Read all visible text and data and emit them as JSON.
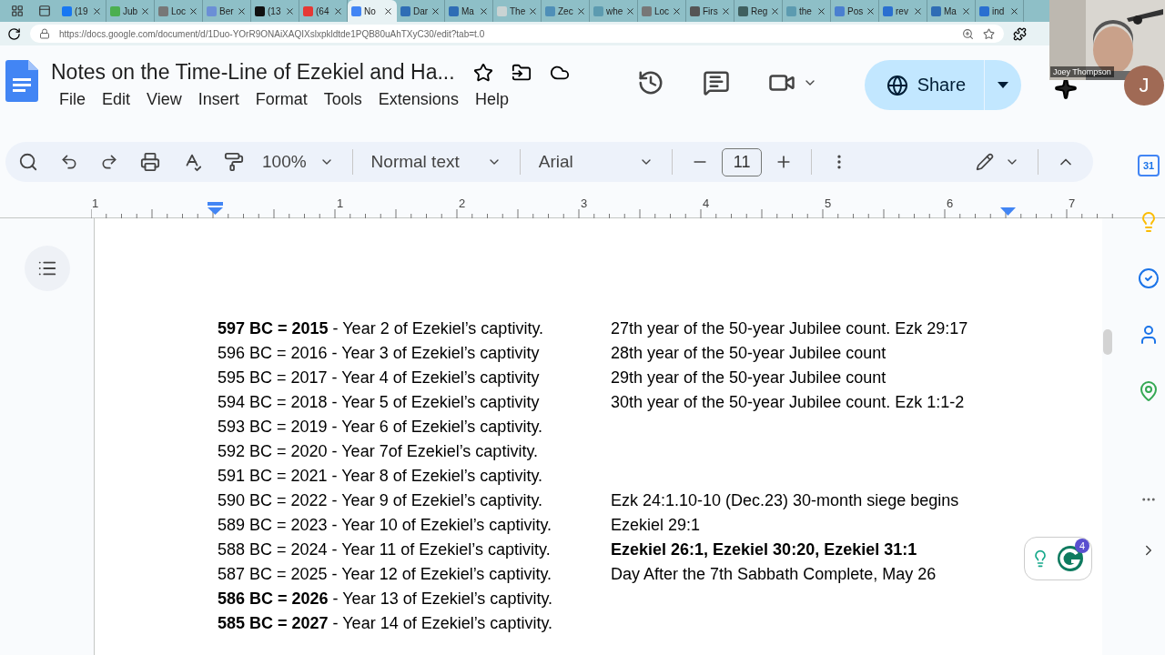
{
  "browser_tabs": [
    {
      "title": "(19",
      "color": "#1877f2",
      "selected": false
    },
    {
      "title": "Jub",
      "color": "#4caf50",
      "selected": false
    },
    {
      "title": "Loc",
      "color": "#777777",
      "selected": false
    },
    {
      "title": "Ber",
      "color": "#6b8fd6",
      "selected": false
    },
    {
      "title": "(13",
      "color": "#111111",
      "selected": false
    },
    {
      "title": "(64",
      "color": "#e53935",
      "selected": false
    },
    {
      "title": "No",
      "color": "#4285f4",
      "selected": true
    },
    {
      "title": "Dar",
      "color": "#2f6db5",
      "selected": false
    },
    {
      "title": "Ma",
      "color": "#2f6db5",
      "selected": false
    },
    {
      "title": "The",
      "color": "#c9d3d3",
      "selected": false
    },
    {
      "title": "Zec",
      "color": "#4f8fb8",
      "selected": false
    },
    {
      "title": "whe",
      "color": "#5c9bb0",
      "selected": false
    },
    {
      "title": "Loc",
      "color": "#777777",
      "selected": false
    },
    {
      "title": "Firs",
      "color": "#555555",
      "selected": false
    },
    {
      "title": "Reg",
      "color": "#3f5f5f",
      "selected": false
    },
    {
      "title": "the",
      "color": "#5c9bb0",
      "selected": false
    },
    {
      "title": "Pos",
      "color": "#4a7fd0",
      "selected": false
    },
    {
      "title": "rev",
      "color": "#2a6fd0",
      "selected": false
    },
    {
      "title": "Ma",
      "color": "#2f6db5",
      "selected": false
    },
    {
      "title": "ind",
      "color": "#2a6fd0",
      "selected": false
    }
  ],
  "address_bar": {
    "url": "https://docs.google.com/document/d/1Duo-YOrR9ONAiXAQIXslxpkldtde1PQB80uAhTXyC30/edit?tab=t.0"
  },
  "webcam": {
    "name": "Joey Thompson"
  },
  "document": {
    "title": "Notes on the Time-Line of Ezekiel and Ha...",
    "menu": [
      "File",
      "Edit",
      "View",
      "Insert",
      "Format",
      "Tools",
      "Extensions",
      "Help"
    ]
  },
  "share_button": {
    "label": "Share"
  },
  "account": {
    "initial": "J"
  },
  "toolbar": {
    "zoom": "100%",
    "style": "Normal text",
    "font": "Arial",
    "font_size": "11"
  },
  "ruler": {
    "labels": [
      "1",
      "1",
      "2",
      "3",
      "4",
      "5",
      "6",
      "7"
    ]
  },
  "lines": [
    {
      "main": "**597 BC = 2015** - Year 2 of Ezekiel’s captivity.",
      "note": "27th year of the 50-year Jubilee count. Ezk 29:17",
      "note_bold": false
    },
    {
      "main": "596 BC = 2016 - Year 3 of Ezekiel’s captivity",
      "note": "28th year of the 50-year Jubilee count",
      "note_bold": false
    },
    {
      "main": "595 BC = 2017 - Year 4 of Ezekiel’s captivity",
      "note": "29th year of the 50-year Jubilee count",
      "note_bold": false
    },
    {
      "main": "594 BC = 2018 - Year 5 of Ezekiel’s captivity",
      "note": "30th year of the 50-year Jubilee count. Ezk 1:1-2",
      "note_bold": false
    },
    {
      "main": "593 BC = 2019 - Year 6 of Ezekiel’s captivity."
    },
    {
      "main": "592 BC = 2020 - Year 7of Ezekiel’s captivity."
    },
    {
      "main": "591 BC = 2021 - Year 8 of Ezekiel’s captivity."
    },
    {
      "main": "590 BC = 2022 - Year 9 of Ezekiel’s captivity.",
      "note": "Ezk 24:1.10-10 (Dec.23) 30-month siege begins",
      "note_bold": false
    },
    {
      "main": "589 BC = 2023 - Year 10 of Ezekiel’s captivity.",
      "note": "Ezekiel 29:1",
      "note_bold": false
    },
    {
      "main": "588 BC = 2024 - Year 11 of Ezekiel’s captivity.",
      "note": "Ezekiel 26:1, Ezekiel 30:20, Ezekiel 31:1",
      "note_bold": true
    },
    {
      "main": "587 BC = 2025 - Year 12 of Ezekiel’s captivity.",
      "note": "Day After the 7th Sabbath Complete, May 26",
      "note_bold": false
    },
    {
      "main": "**586 BC = 2026** - Year 13 of Ezekiel’s captivity."
    },
    {
      "main": "**585 BC = 2027** - Year 14 of Ezekiel’s captivity."
    }
  ],
  "side_panel": {
    "calendar_day": "31"
  },
  "grammarly": {
    "count": "4"
  }
}
